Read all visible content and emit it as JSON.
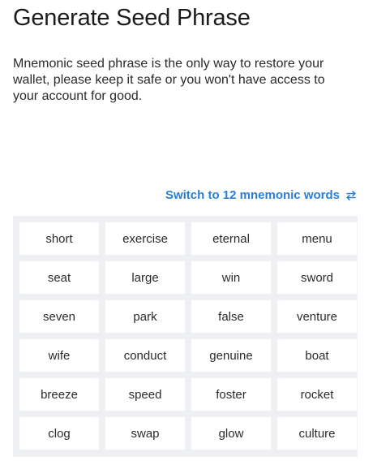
{
  "header": {
    "title": "Generate Seed Phrase"
  },
  "intro": {
    "text": "Mnemonic seed phrase is the only way to restore your wallet, please keep it safe or you won't have access to your account for good."
  },
  "switch": {
    "label": "Switch to 12 mnemonic words",
    "icon": "swap-arrows-icon",
    "color": "#2a7fd4"
  },
  "mnemonic": {
    "words": [
      "short",
      "exercise",
      "eternal",
      "menu",
      "seat",
      "large",
      "win",
      "sword",
      "seven",
      "park",
      "false",
      "venture",
      "wife",
      "conduct",
      "genuine",
      "boat",
      "breeze",
      "speed",
      "foster",
      "rocket",
      "clog",
      "swap",
      "glow",
      "culture"
    ]
  }
}
